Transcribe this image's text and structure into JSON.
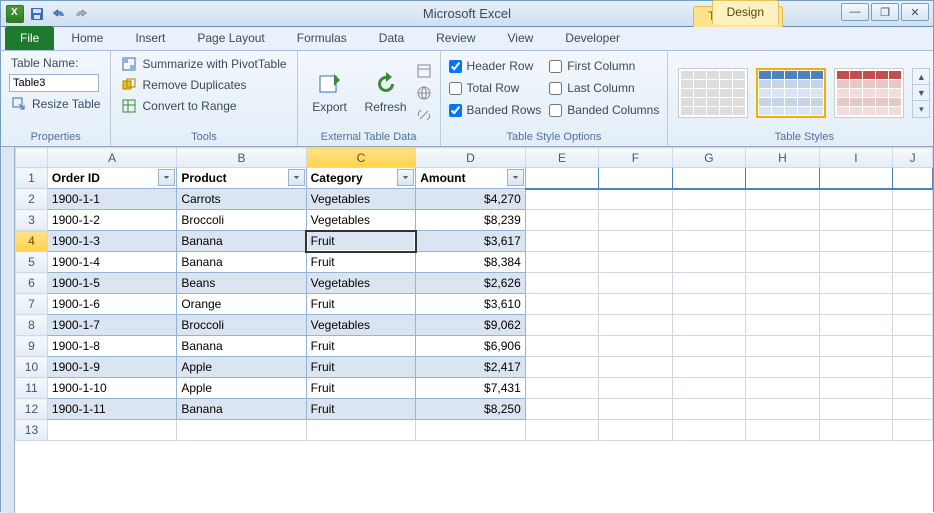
{
  "app_title": "Microsoft Excel",
  "contextual_tab_group": "Table Tools",
  "tabs": {
    "file": "File",
    "list": [
      "Home",
      "Insert",
      "Page Layout",
      "Formulas",
      "Data",
      "Review",
      "View",
      "Developer"
    ],
    "design": "Design"
  },
  "ribbon": {
    "properties": {
      "label": "Properties",
      "table_name_label": "Table Name:",
      "table_name_value": "Table3",
      "resize": "Resize Table"
    },
    "tools": {
      "label": "Tools",
      "pivot": "Summarize with PivotTable",
      "dupes": "Remove Duplicates",
      "range": "Convert to Range"
    },
    "ext": {
      "label": "External Table Data",
      "export": "Export",
      "refresh": "Refresh"
    },
    "style_opts": {
      "label": "Table Style Options",
      "header": "Header Row",
      "total": "Total Row",
      "banded_rows": "Banded Rows",
      "first_col": "First Column",
      "last_col": "Last Column",
      "banded_cols": "Banded Columns",
      "checked": {
        "header": true,
        "total": false,
        "banded_rows": true,
        "first_col": false,
        "last_col": false,
        "banded_cols": false
      }
    },
    "styles": {
      "label": "Table Styles"
    }
  },
  "columns": [
    "A",
    "B",
    "C",
    "D",
    "E",
    "F",
    "G",
    "H",
    "I",
    "J"
  ],
  "active_col": "C",
  "active_row": 4,
  "table": {
    "headers": [
      "Order ID",
      "Product",
      "Category",
      "Amount"
    ],
    "rows": [
      {
        "n": 2,
        "id": "1900-1-1",
        "product": "Carrots",
        "category": "Vegetables",
        "amount": "$4,270"
      },
      {
        "n": 3,
        "id": "1900-1-2",
        "product": "Broccoli",
        "category": "Vegetables",
        "amount": "$8,239"
      },
      {
        "n": 4,
        "id": "1900-1-3",
        "product": "Banana",
        "category": "Fruit",
        "amount": "$3,617"
      },
      {
        "n": 5,
        "id": "1900-1-4",
        "product": "Banana",
        "category": "Fruit",
        "amount": "$8,384"
      },
      {
        "n": 6,
        "id": "1900-1-5",
        "product": "Beans",
        "category": "Vegetables",
        "amount": "$2,626"
      },
      {
        "n": 7,
        "id": "1900-1-6",
        "product": "Orange",
        "category": "Fruit",
        "amount": "$3,610"
      },
      {
        "n": 8,
        "id": "1900-1-7",
        "product": "Broccoli",
        "category": "Vegetables",
        "amount": "$9,062"
      },
      {
        "n": 9,
        "id": "1900-1-8",
        "product": "Banana",
        "category": "Fruit",
        "amount": "$6,906"
      },
      {
        "n": 10,
        "id": "1900-1-9",
        "product": "Apple",
        "category": "Fruit",
        "amount": "$2,417"
      },
      {
        "n": 11,
        "id": "1900-1-10",
        "product": "Apple",
        "category": "Fruit",
        "amount": "$7,431"
      },
      {
        "n": 12,
        "id": "1900-1-11",
        "product": "Banana",
        "category": "Fruit",
        "amount": "$8,250"
      }
    ]
  },
  "header_row_num": 1,
  "empty_row_num": 13
}
